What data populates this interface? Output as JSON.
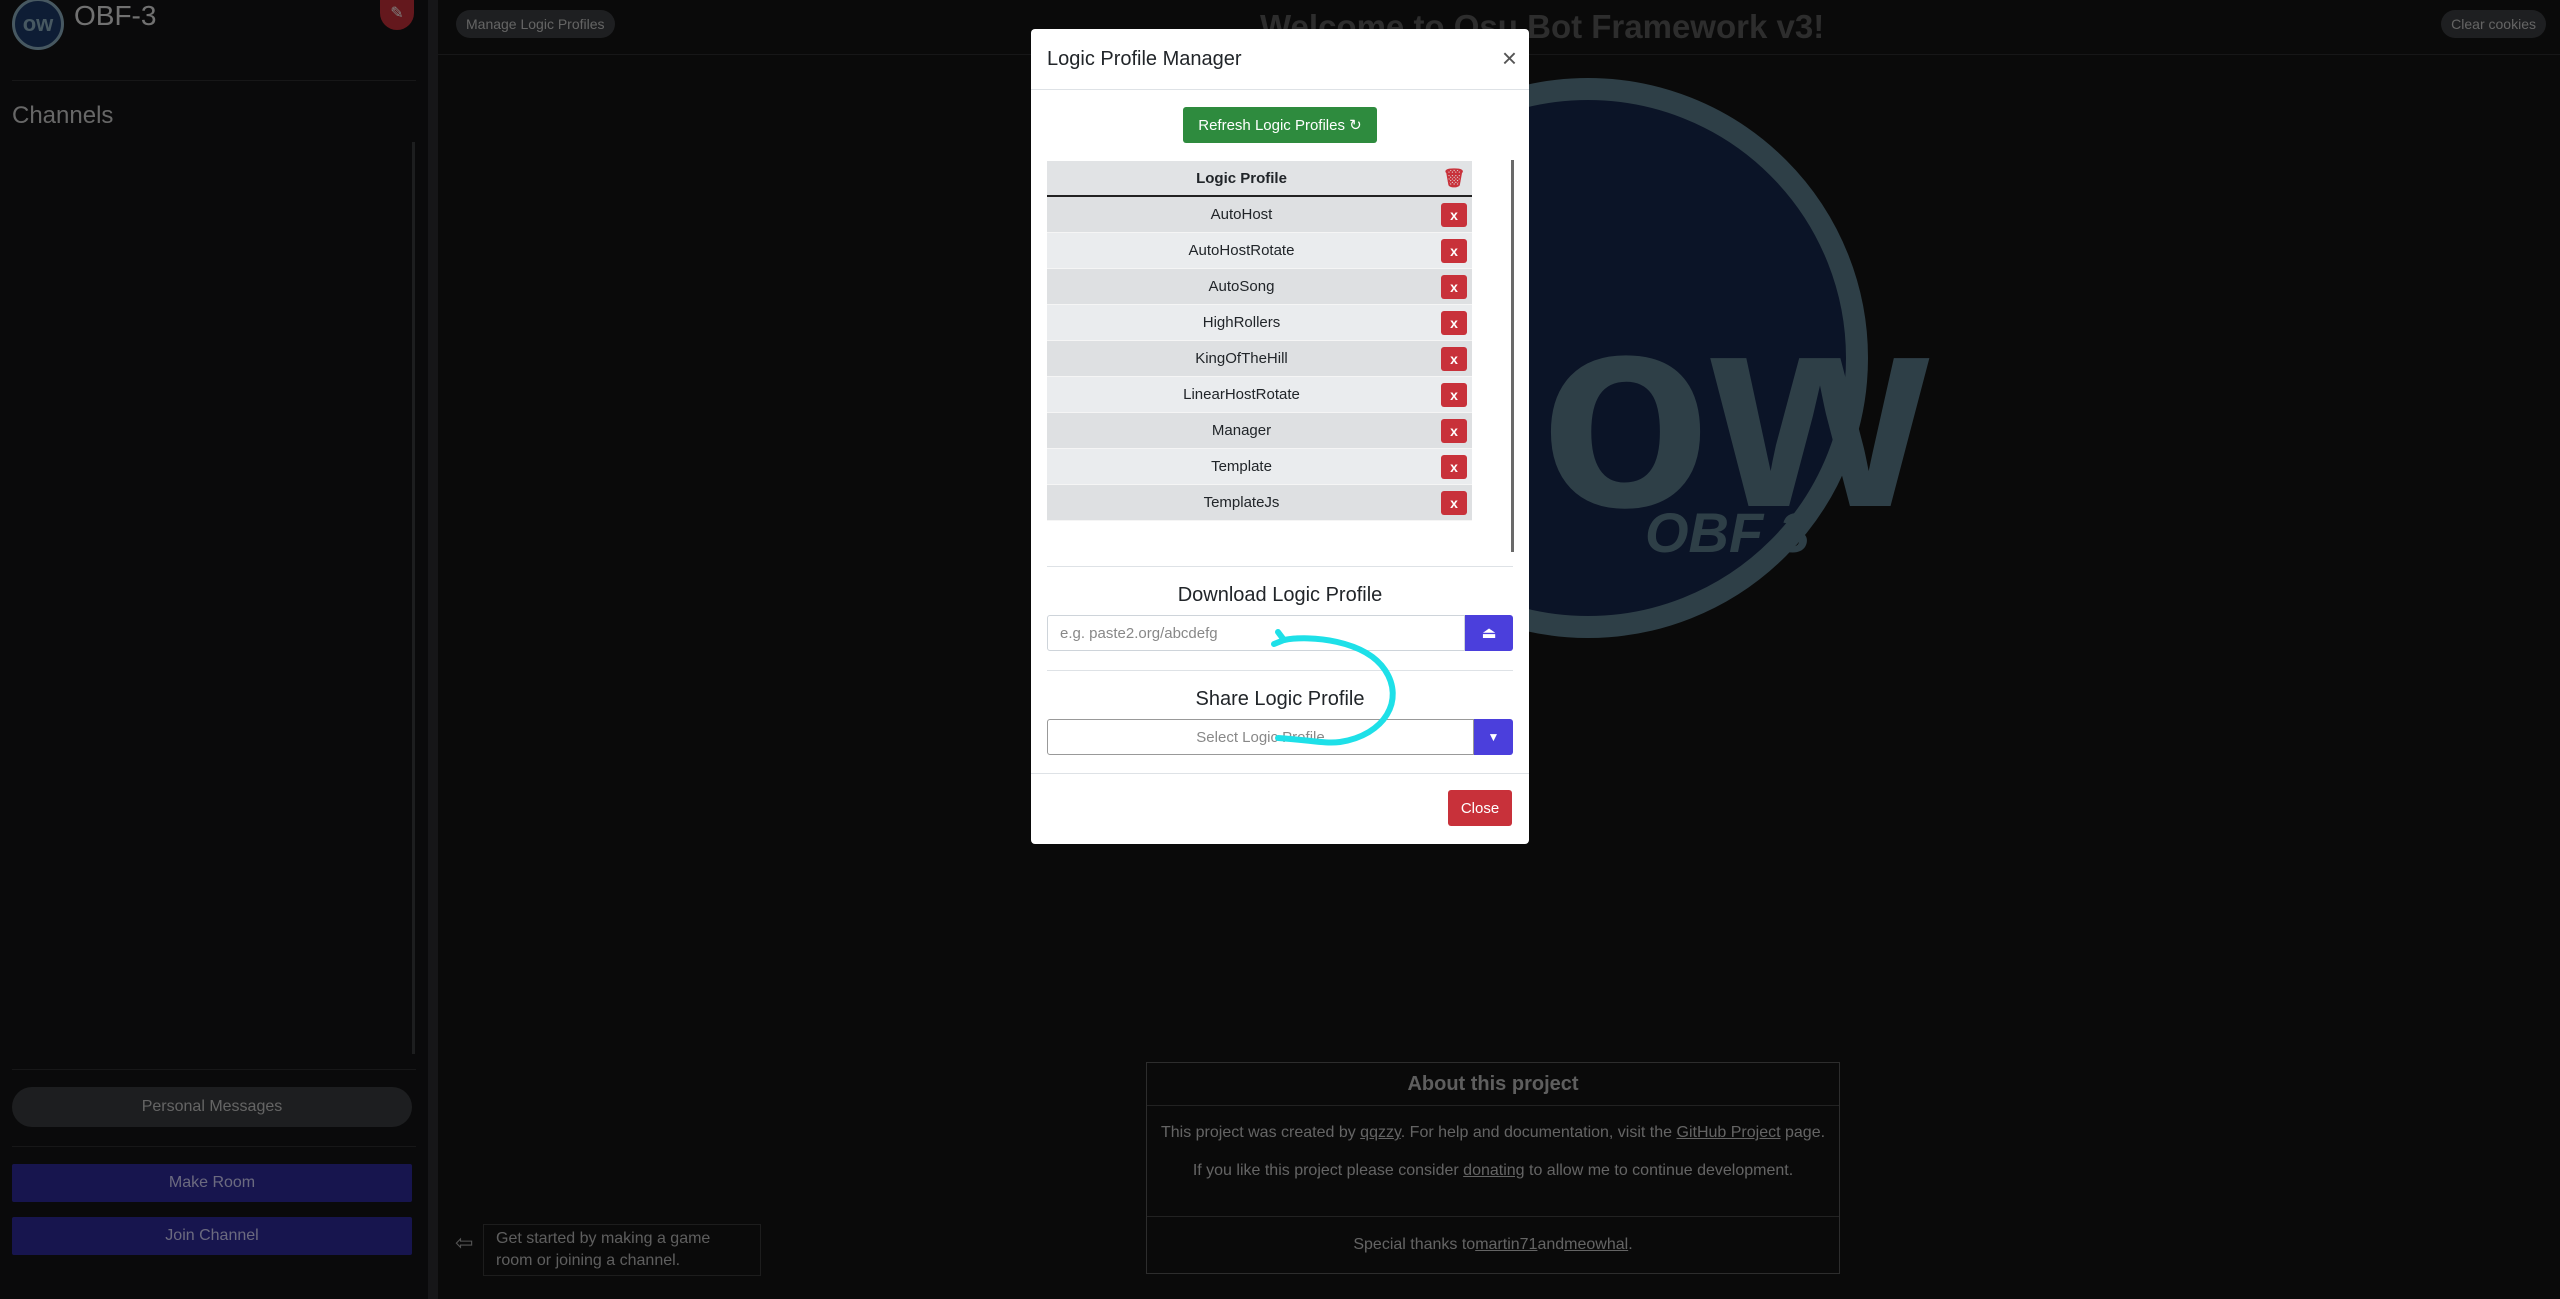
{
  "sidebar": {
    "brand": "OBF-3",
    "logo_text": "ow",
    "channels_heading": "Channels",
    "personal_messages": "Personal Messages",
    "make_room": "Make Room",
    "join_channel": "Join Channel"
  },
  "topbar": {
    "manage_profiles": "Manage Logic Profiles",
    "welcome": "Welcome to Osu Bot Framework v3!",
    "clear_cookies": "Clear cookies"
  },
  "background_logo": {
    "main": "ow",
    "sub": "OBF 3"
  },
  "about": {
    "title": "About this project",
    "line1_a": "This project was created by ",
    "line1_link": "qqzzy",
    "line1_b": ". For help and documentation, visit the ",
    "line1_link2": "GitHub Project",
    "line1_c": " page.",
    "line2_a": "If you like this project please consider ",
    "line2_link": "donating",
    "line2_b": " to allow me to continue development.",
    "thanks_a": "Special thanks to ",
    "thanks_link1": "martin71",
    "thanks_and": " and ",
    "thanks_link2": "meowhal",
    "thanks_end": "."
  },
  "hint": {
    "arrow": "⇦",
    "text": "Get started by making a game room or joining a channel."
  },
  "modal": {
    "title": "Logic Profile Manager",
    "close_icon": "×",
    "refresh_label": "Refresh Logic Profiles ↻",
    "table_header": "Logic Profile",
    "delete_label": "x",
    "profiles": [
      "AutoHost",
      "AutoHostRotate",
      "AutoSong",
      "HighRollers",
      "KingOfTheHill",
      "LinearHostRotate",
      "Manager",
      "Template",
      "TemplateJs"
    ],
    "download_title": "Download Logic Profile",
    "download_placeholder": "e.g. paste2.org/abcdefg",
    "share_title": "Share Logic Profile",
    "share_select": "Select Logic Profile",
    "close_button": "Close"
  },
  "colors": {
    "accent_blue": "#4b3fdc",
    "danger": "#c8313a",
    "success": "#2e8b3e",
    "annotation": "#1ee0e8"
  }
}
